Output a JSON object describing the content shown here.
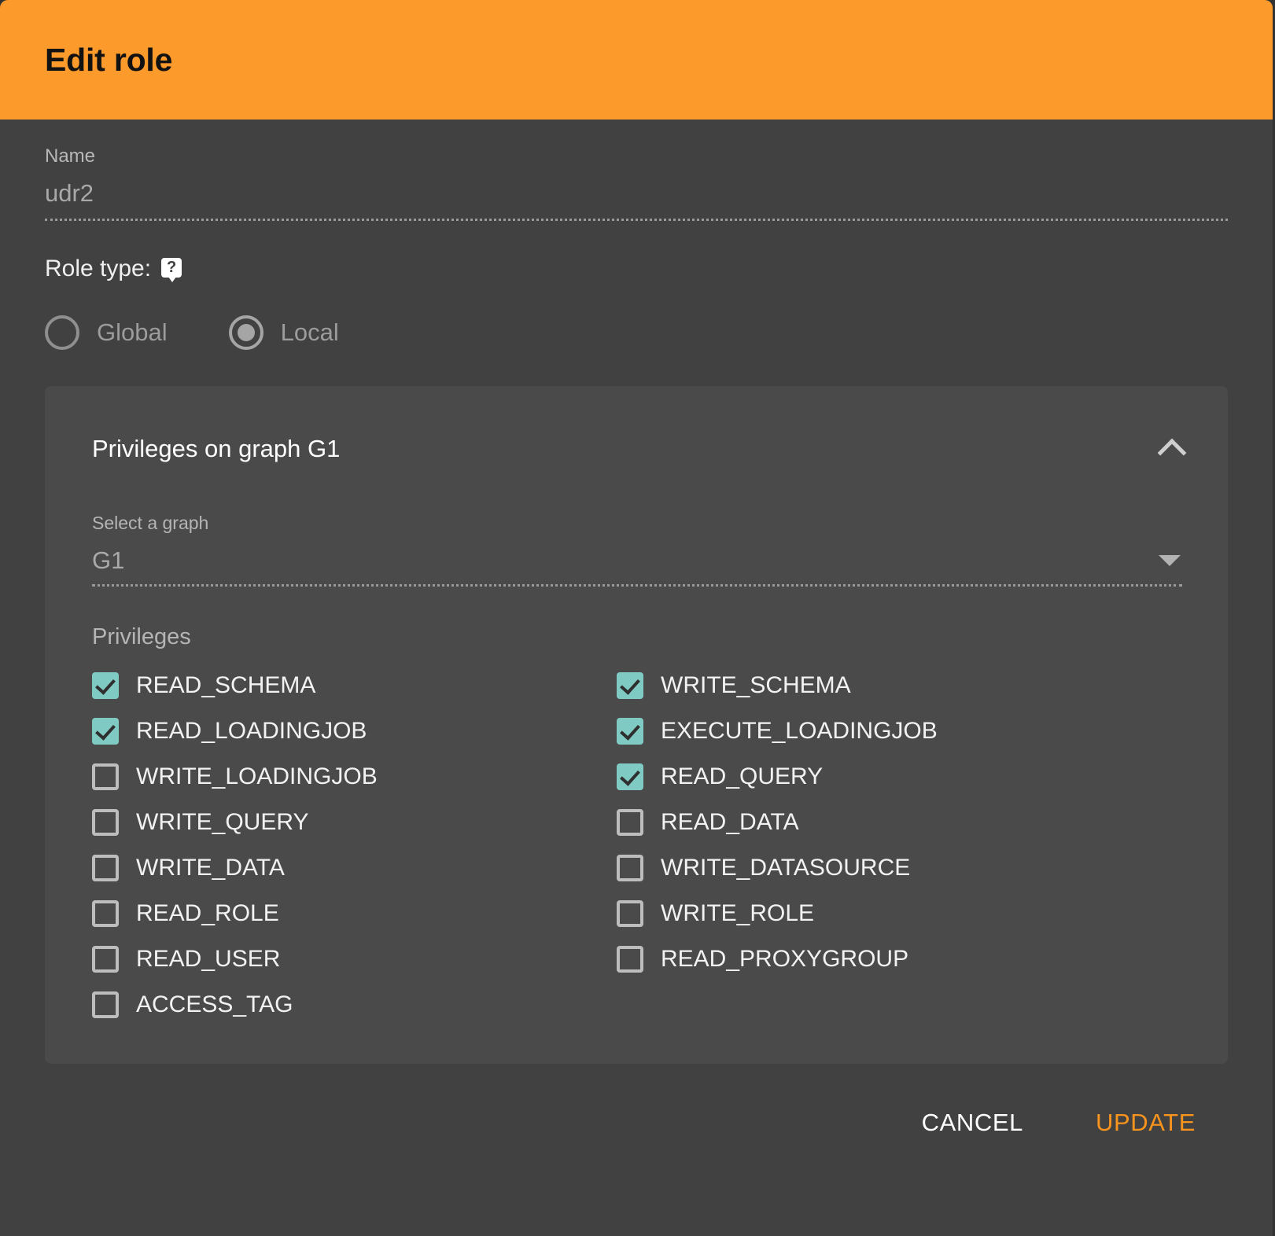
{
  "dialog": {
    "title": "Edit role",
    "accent_color": "#FC9A2B",
    "background_color": "#414141",
    "card_color": "#4A4A4A",
    "checkbox_checked_color": "#7FCBC4",
    "update_color": "#F8941D"
  },
  "name_field": {
    "label": "Name",
    "value": "udr2"
  },
  "role_type": {
    "label": "Role type:",
    "help_icon_glyph": "?",
    "options": [
      {
        "label": "Global",
        "selected": false
      },
      {
        "label": "Local",
        "selected": true
      }
    ]
  },
  "privileges_panel": {
    "header_title": "Privileges on graph G1",
    "collapse_icon": "chevron-up-icon",
    "graph_select": {
      "label": "Select a graph",
      "value": "G1",
      "dropdown_icon": "caret-down-icon"
    },
    "privileges_title": "Privileges",
    "left_column": [
      {
        "label": "READ_SCHEMA",
        "checked": true
      },
      {
        "label": "READ_LOADINGJOB",
        "checked": true
      },
      {
        "label": "WRITE_LOADINGJOB",
        "checked": false
      },
      {
        "label": "WRITE_QUERY",
        "checked": false
      },
      {
        "label": "WRITE_DATA",
        "checked": false
      },
      {
        "label": "READ_ROLE",
        "checked": false
      },
      {
        "label": "READ_USER",
        "checked": false
      },
      {
        "label": "ACCESS_TAG",
        "checked": false
      }
    ],
    "right_column": [
      {
        "label": "WRITE_SCHEMA",
        "checked": true
      },
      {
        "label": "EXECUTE_LOADINGJOB",
        "checked": true
      },
      {
        "label": "READ_QUERY",
        "checked": true
      },
      {
        "label": "READ_DATA",
        "checked": false
      },
      {
        "label": "WRITE_DATASOURCE",
        "checked": false
      },
      {
        "label": "WRITE_ROLE",
        "checked": false
      },
      {
        "label": "READ_PROXYGROUP",
        "checked": false
      }
    ]
  },
  "footer": {
    "cancel_label": "CANCEL",
    "update_label": "UPDATE"
  }
}
